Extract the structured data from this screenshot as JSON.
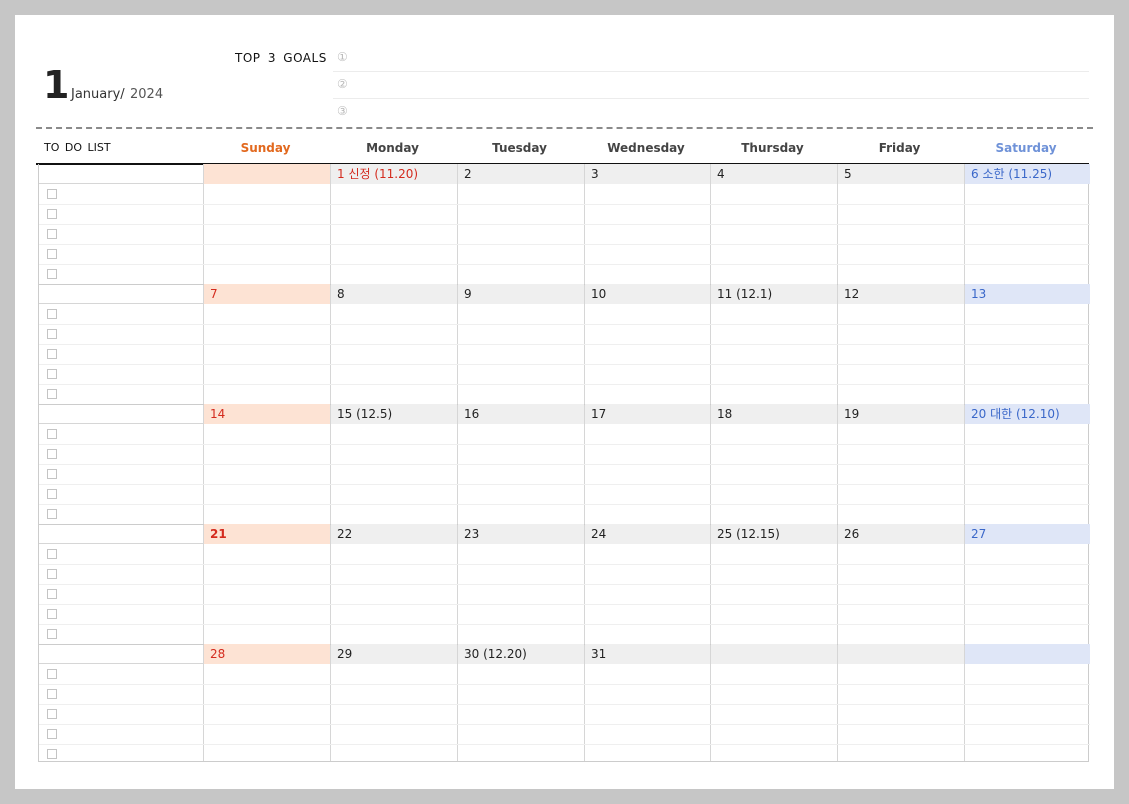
{
  "header": {
    "month_number": "1",
    "month_name": "January/",
    "year": "2024",
    "goals_title": "TOP 3 GOALS",
    "goals": [
      "①",
      "②",
      "③"
    ]
  },
  "columns": {
    "todo": "TO DO LIST",
    "days": [
      "Sunday",
      "Monday",
      "Tuesday",
      "Wednesday",
      "Thursday",
      "Friday",
      "Saturday"
    ]
  },
  "colors": {
    "sunday_text": "#d42b1e",
    "sunday_header": "#e2691f",
    "saturday_text": "#3a67c9",
    "saturday_header": "#6f92d8",
    "sunday_bg": "#fde3d4",
    "weekday_bg": "#efefef",
    "saturday_bg": "#dfe6f7"
  },
  "weeks": [
    [
      "",
      "1  신정  (11.20)",
      "2",
      "3",
      "4",
      "5",
      "6  소한  (11.25)"
    ],
    [
      "7",
      "8",
      "9",
      "10",
      "11  (12.1)",
      "12",
      "13"
    ],
    [
      "14",
      "15  (12.5)",
      "16",
      "17",
      "18",
      "19",
      "20  대한  (12.10)"
    ],
    [
      "21",
      "22",
      "23",
      "24",
      "25  (12.15)",
      "26",
      "27"
    ],
    [
      "28",
      "29",
      "30  (12.20)",
      "31",
      "",
      "",
      ""
    ]
  ],
  "todo_checkbox_icon": "checkbox-icon"
}
